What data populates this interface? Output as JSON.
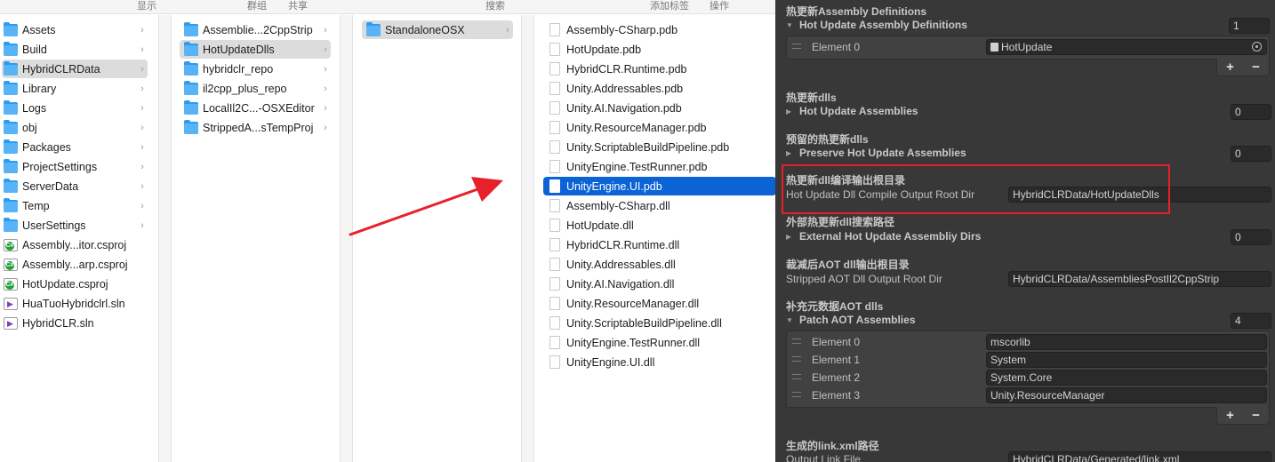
{
  "finder": {
    "toolbar": {
      "view": "显示",
      "group": "群组",
      "share": "共享",
      "search": "搜索",
      "add_tag": "添加标签",
      "action": "操作"
    },
    "column1": [
      {
        "name": "Assets",
        "type": "folder"
      },
      {
        "name": "Build",
        "type": "folder"
      },
      {
        "name": "HybridCLRData",
        "type": "folder",
        "selected": true
      },
      {
        "name": "Library",
        "type": "folder"
      },
      {
        "name": "Logs",
        "type": "folder"
      },
      {
        "name": "obj",
        "type": "folder"
      },
      {
        "name": "Packages",
        "type": "folder"
      },
      {
        "name": "ProjectSettings",
        "type": "folder"
      },
      {
        "name": "ServerData",
        "type": "folder"
      },
      {
        "name": "Temp",
        "type": "folder"
      },
      {
        "name": "UserSettings",
        "type": "folder"
      },
      {
        "name": "Assembly...itor.csproj",
        "type": "csproj"
      },
      {
        "name": "Assembly...arp.csproj",
        "type": "csproj"
      },
      {
        "name": "HotUpdate.csproj",
        "type": "csproj"
      },
      {
        "name": "HuaTuoHybridclrl.sln",
        "type": "sln"
      },
      {
        "name": "HybridCLR.sln",
        "type": "sln"
      }
    ],
    "column2": [
      {
        "name": "Assemblie...2CppStrip",
        "type": "folder"
      },
      {
        "name": "HotUpdateDlls",
        "type": "folder",
        "selected": true
      },
      {
        "name": "hybridclr_repo",
        "type": "folder"
      },
      {
        "name": "il2cpp_plus_repo",
        "type": "folder"
      },
      {
        "name": "LocalIl2C...-OSXEditor",
        "type": "folder"
      },
      {
        "name": "StrippedA...sTempProj",
        "type": "folder"
      }
    ],
    "column3": [
      {
        "name": "StandaloneOSX",
        "type": "folder",
        "selected": true
      }
    ],
    "column4": [
      {
        "name": "Assembly-CSharp.pdb"
      },
      {
        "name": "HotUpdate.pdb"
      },
      {
        "name": "HybridCLR.Runtime.pdb"
      },
      {
        "name": "Unity.Addressables.pdb"
      },
      {
        "name": "Unity.AI.Navigation.pdb"
      },
      {
        "name": "Unity.ResourceManager.pdb"
      },
      {
        "name": "Unity.ScriptableBuildPipeline.pdb"
      },
      {
        "name": "UnityEngine.TestRunner.pdb"
      },
      {
        "name": "UnityEngine.UI.pdb",
        "selected": true
      },
      {
        "name": "Assembly-CSharp.dll"
      },
      {
        "name": "HotUpdate.dll"
      },
      {
        "name": "HybridCLR.Runtime.dll"
      },
      {
        "name": "Unity.Addressables.dll"
      },
      {
        "name": "Unity.AI.Navigation.dll"
      },
      {
        "name": "Unity.ResourceManager.dll"
      },
      {
        "name": "Unity.ScriptableBuildPipeline.dll"
      },
      {
        "name": "UnityEngine.TestRunner.dll"
      },
      {
        "name": "UnityEngine.UI.dll"
      }
    ],
    "colors": {
      "selection_blue": "#0b63d6",
      "selection_gray": "#dcdcdc",
      "folder": "#58b4f6",
      "arrow": "#e8202a"
    }
  },
  "inspector": {
    "s1": {
      "heading": "热更新Assembly Definitions",
      "fold": "Hot Update Assembly Definitions",
      "count": "1",
      "elements": [
        {
          "name": "Element 0",
          "value": "HotUpdate"
        }
      ]
    },
    "s2": {
      "heading": "热更新dlls",
      "fold": "Hot Update Assemblies",
      "count": "0"
    },
    "s3": {
      "heading": "预留的热更新dlls",
      "fold": "Preserve Hot Update Assemblies",
      "count": "0"
    },
    "s4": {
      "heading": "热更新dll编译输出根目录",
      "label": "Hot Update Dll Compile Output Root Dir",
      "value": "HybridCLRData/HotUpdateDlls"
    },
    "s5": {
      "heading": "外部热更新dll搜索路径",
      "fold": "External Hot Update Assembliy Dirs",
      "count": "0"
    },
    "s6": {
      "heading": "裁减后AOT dll输出根目录",
      "label": "Stripped AOT Dll Output Root Dir",
      "value": "HybridCLRData/AssembliesPostIl2CppStrip"
    },
    "s7": {
      "heading": "补充元数据AOT dlls",
      "fold": "Patch AOT Assemblies",
      "count": "4",
      "elements": [
        {
          "name": "Element 0",
          "value": "mscorlib"
        },
        {
          "name": "Element 1",
          "value": "System"
        },
        {
          "name": "Element 2",
          "value": "System.Core"
        },
        {
          "name": "Element 3",
          "value": "Unity.ResourceManager"
        }
      ]
    },
    "s8": {
      "heading": "生成的link.xml路径",
      "label": "Output Link File",
      "value": "HybridCLRData/Generated/link.xml"
    },
    "plus": "+",
    "minus": "−",
    "colors": {
      "background": "#383838",
      "field": "#2a2a2a",
      "highlight": "#e8202a"
    }
  }
}
